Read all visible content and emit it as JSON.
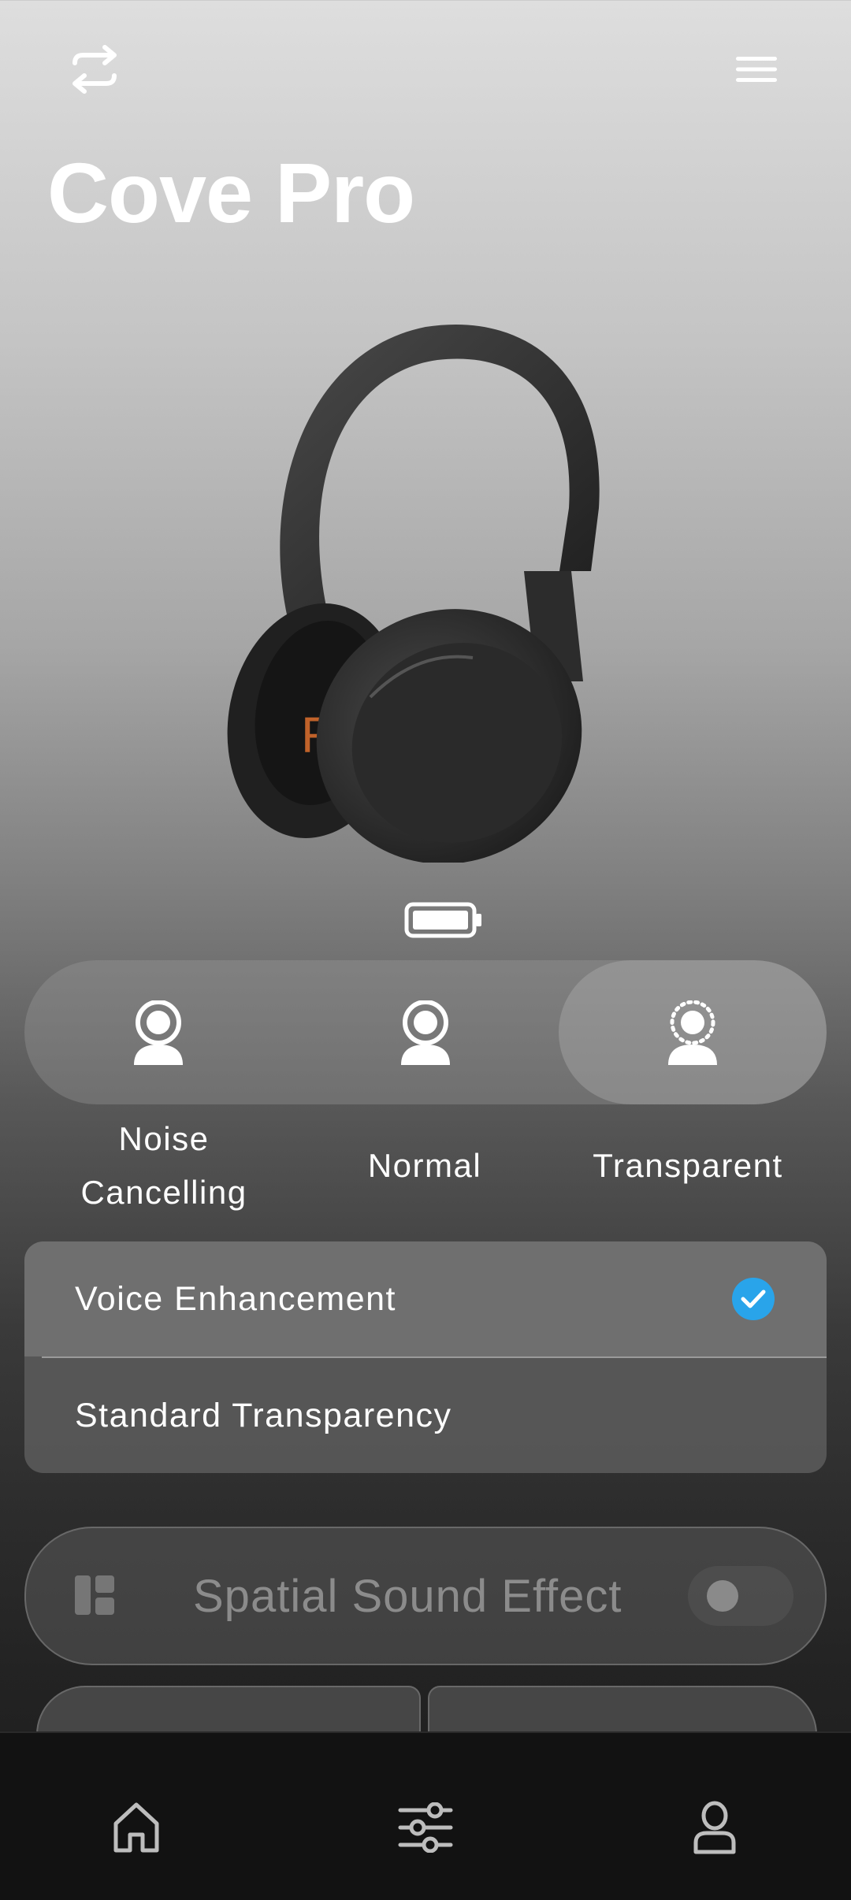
{
  "header": {
    "title": "Cove Pro",
    "switch_icon": "device-switch-icon",
    "menu_icon": "hamburger-menu-icon"
  },
  "device": {
    "battery_icon": "battery-full-icon",
    "battery_level": 1.0
  },
  "modes": {
    "items": [
      {
        "label": "Noise\nCancelling",
        "icon": "person-noise-cancelling-icon"
      },
      {
        "label": "Normal",
        "icon": "person-normal-icon"
      },
      {
        "label": "Transparent",
        "icon": "person-transparent-icon"
      }
    ],
    "active": "Transparent"
  },
  "transparency_options": {
    "items": [
      {
        "label": "Voice Enhancement",
        "selected": true
      },
      {
        "label": "Standard Transparency",
        "selected": false
      }
    ],
    "check_color": "#29a4ea"
  },
  "spatial_sound": {
    "label": "Spatial Sound Effect",
    "icon": "spatial-grid-icon",
    "enabled": false
  },
  "bottom_nav": {
    "items": [
      "home-icon",
      "equalizer-sliders-icon",
      "profile-icon"
    ]
  }
}
